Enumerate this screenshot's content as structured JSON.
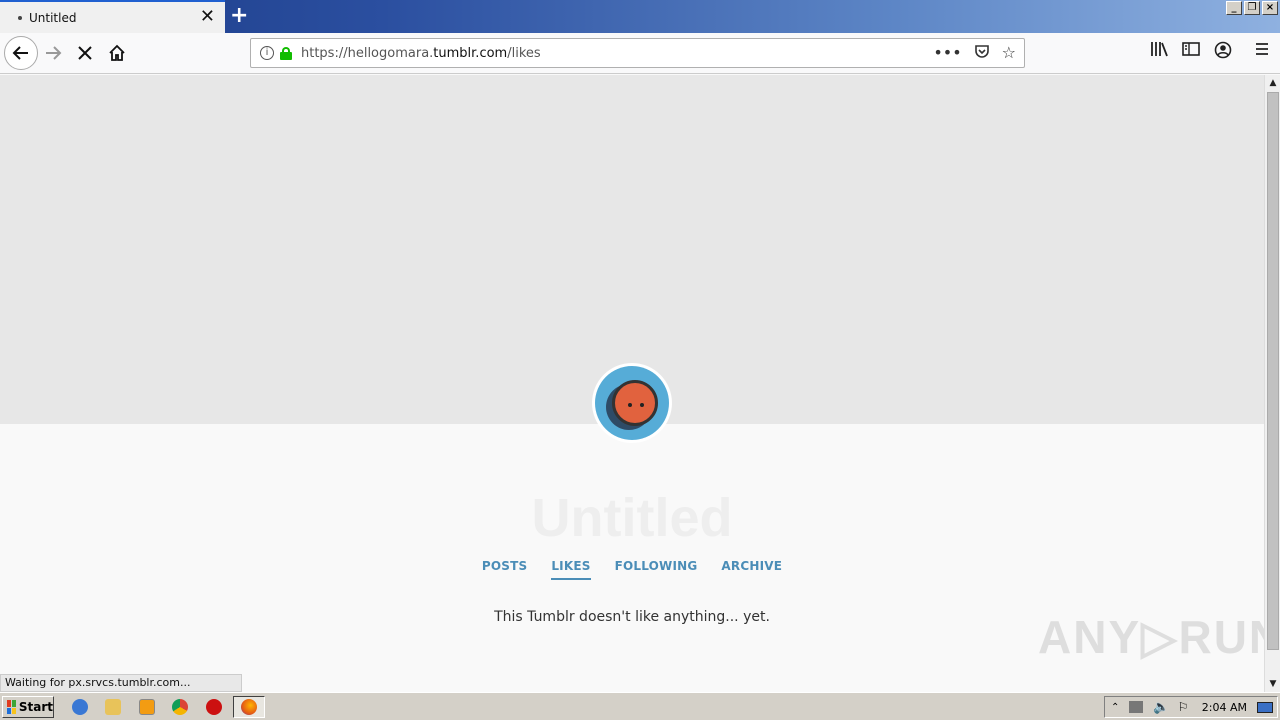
{
  "browser": {
    "tab_title": "Untitled",
    "tab_close": "✕",
    "new_tab": "+",
    "url_prefix": "https://hellogomara.",
    "url_domain": "tumblr.com",
    "url_path": "/likes",
    "status_text": "Waiting for px.srvcs.tumblr.com..."
  },
  "page": {
    "blog_title": "Untitled",
    "nav": [
      "POSTS",
      "LIKES",
      "FOLLOWING",
      "ARCHIVE"
    ],
    "active_nav": "LIKES",
    "empty_message": "This Tumblr doesn't like anything... yet.",
    "accent_color": "#4b8db7",
    "avatar_color": "#56acd7"
  },
  "watermark": "ANY▷RUN",
  "taskbar": {
    "start_label": "Start",
    "clock": "2:04 AM"
  }
}
